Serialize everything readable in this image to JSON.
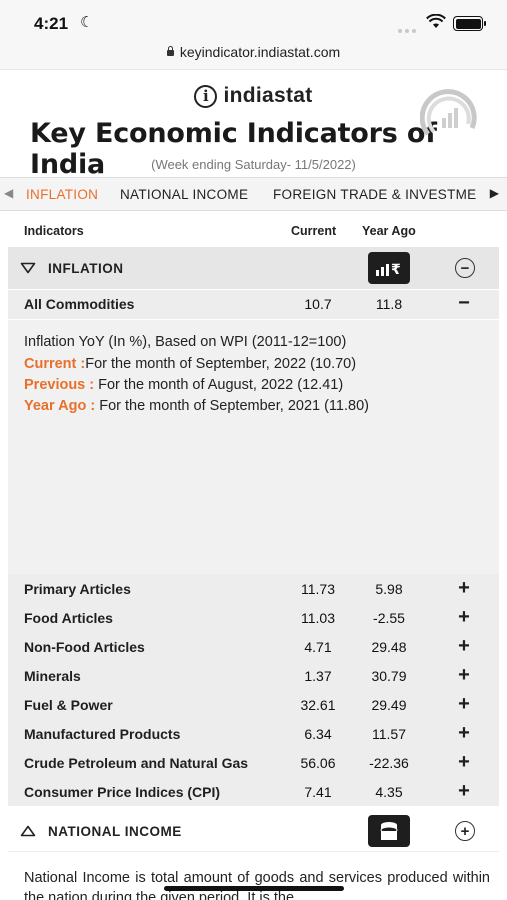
{
  "status_bar": {
    "time": "4:21",
    "moon": "☾"
  },
  "browser": {
    "url": "keyindicator.indiastat.com"
  },
  "header": {
    "brand": "indiastat",
    "title": "Key Economic Indicators of India",
    "week": "(Week ending Saturday- 11/5/2022)"
  },
  "tabs": {
    "left_arrow": "◀",
    "right_arrow": "▶",
    "items": [
      "INFLATION",
      "NATIONAL INCOME",
      "FOREIGN TRADE & INVESTME"
    ]
  },
  "columns": {
    "indicators": "Indicators",
    "current": "Current",
    "year_ago": "Year Ago"
  },
  "inflation": {
    "label": "INFLATION",
    "toggle": "−",
    "all_commodities": {
      "name": "All Commodities",
      "current": "10.7",
      "year_ago": "11.8",
      "action": "−"
    },
    "detail": {
      "line1": "Inflation YoY (In %), Based on WPI (2011-12=100)",
      "current_key": "Current :",
      "current_val": "For the month of September, 2022 (10.70)",
      "previous_key": "Previous :",
      "previous_val": " For the month of August, 2022 (12.41)",
      "yearago_key": "Year Ago :",
      "yearago_val": " For the month of September, 2021 (11.80)"
    },
    "rows": [
      {
        "name": "Primary Articles",
        "current": "11.73",
        "year_ago": "5.98",
        "action": "+"
      },
      {
        "name": "Food Articles",
        "current": "11.03",
        "year_ago": "-2.55",
        "action": "+"
      },
      {
        "name": "Non-Food Articles",
        "current": "4.71",
        "year_ago": "29.48",
        "action": "+"
      },
      {
        "name": "Minerals",
        "current": "1.37",
        "year_ago": "30.79",
        "action": "+"
      },
      {
        "name": "Fuel & Power",
        "current": "32.61",
        "year_ago": "29.49",
        "action": "+"
      },
      {
        "name": "Manufactured Products",
        "current": "6.34",
        "year_ago": "11.57",
        "action": "+"
      },
      {
        "name": "Crude Petroleum and Natural Gas",
        "current": "56.06",
        "year_ago": "-22.36",
        "action": "+"
      },
      {
        "name": "Consumer Price Indices (CPI)",
        "current": "7.41",
        "year_ago": "4.35",
        "action": "+"
      }
    ]
  },
  "national_income": {
    "label": "NATIONAL INCOME",
    "toggle": "+",
    "text": "National Income is total amount of goods and services produced within the nation during the given period. It is the"
  },
  "colors": {
    "accent": "#e8702a",
    "section_bg": "#e6e6e6"
  }
}
